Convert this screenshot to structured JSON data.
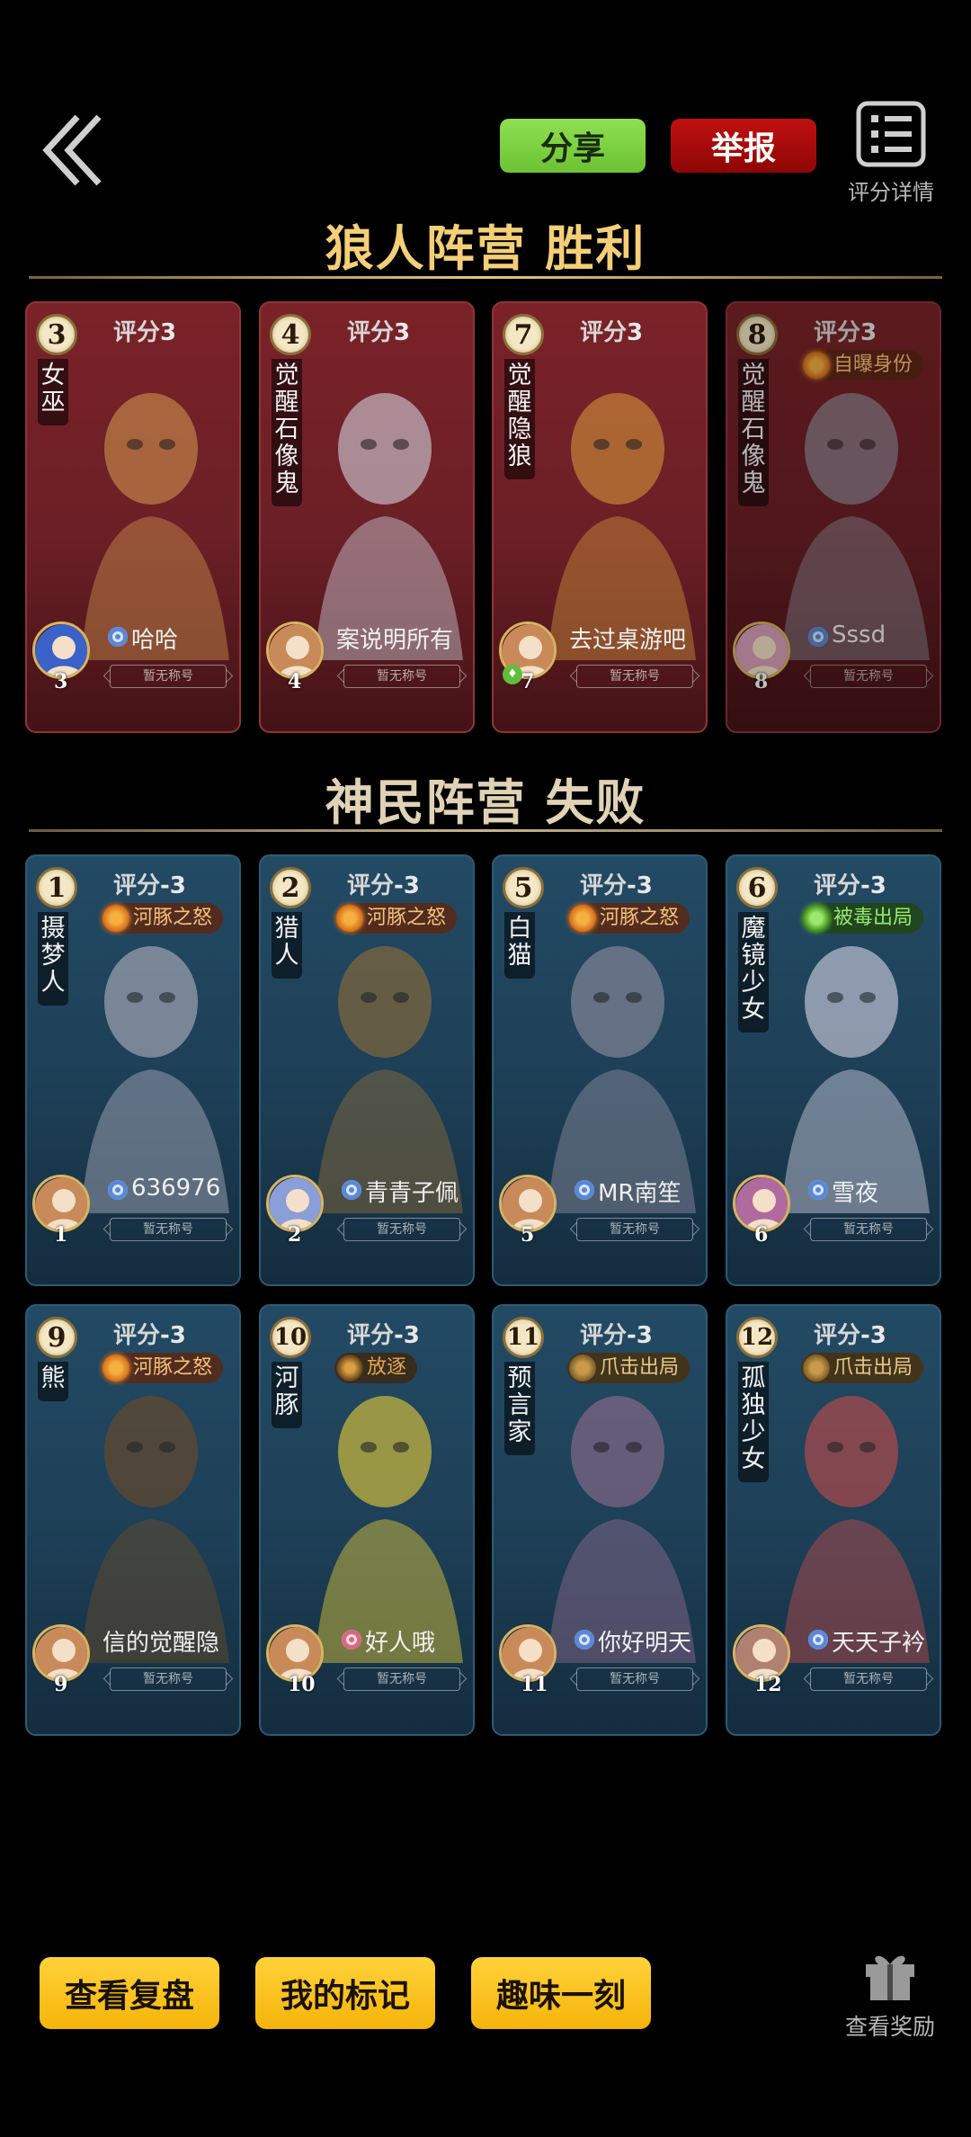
{
  "header": {
    "share_label": "分享",
    "report_label": "举报",
    "detail_label": "评分详情"
  },
  "sections": {
    "wolf_title": "狼人阵营  胜利",
    "villager_title": "神民阵营  失败"
  },
  "score_label": "评分",
  "no_nickname_label": "暂无称号",
  "players": {
    "wolf": [
      {
        "seat": "3",
        "score": "3",
        "role": "女巫",
        "nickname": "哈哈",
        "gender": "male",
        "badge": ""
      },
      {
        "seat": "4",
        "score": "3",
        "role": "觉醒石像鬼",
        "nickname": "案说明所有",
        "gender": "",
        "badge": ""
      },
      {
        "seat": "7",
        "score": "3",
        "role": "觉醒隐狼",
        "nickname": "去过桌游吧",
        "gender": "",
        "badge": ""
      },
      {
        "seat": "8",
        "score": "3",
        "role": "觉醒石像鬼",
        "nickname": "Sssd",
        "gender": "male",
        "badge": "自曝身份"
      }
    ],
    "villager": [
      {
        "seat": "1",
        "score": "-3",
        "role": "摄梦人",
        "nickname": "636976",
        "gender": "male",
        "badge": "河豚之怒"
      },
      {
        "seat": "2",
        "score": "-3",
        "role": "猎人",
        "nickname": "青青子佩",
        "gender": "male",
        "badge": "河豚之怒"
      },
      {
        "seat": "5",
        "score": "-3",
        "role": "白猫",
        "nickname": "MR南笙",
        "gender": "male",
        "badge": "河豚之怒"
      },
      {
        "seat": "6",
        "score": "-3",
        "role": "魔镜少女",
        "nickname": "雪夜",
        "gender": "male",
        "badge": "被毒出局"
      },
      {
        "seat": "9",
        "score": "-3",
        "role": "熊",
        "nickname": "信的觉醒隐",
        "gender": "",
        "badge": "河豚之怒"
      },
      {
        "seat": "10",
        "score": "-3",
        "role": "河豚",
        "nickname": "好人哦",
        "gender": "female",
        "badge": "放逐"
      },
      {
        "seat": "11",
        "score": "-3",
        "role": "预言家",
        "nickname": "你好明天",
        "gender": "male",
        "badge": "爪击出局"
      },
      {
        "seat": "12",
        "score": "-3",
        "role": "孤独少女",
        "nickname": "天天子衿",
        "gender": "male",
        "badge": "爪击出局"
      }
    ]
  },
  "bottom": {
    "replay_label": "查看复盘",
    "marks_label": "我的标记",
    "fun_label": "趣味一刻",
    "reward_label": "查看奖励"
  },
  "colors": {
    "wolf_card": "#6b1f26",
    "villager_card": "#1d3f56",
    "title_gold": "#f4cf77",
    "share_green": "#7fd044",
    "report_red": "#a80808",
    "bottom_yellow": "#fcc526"
  },
  "icons": {
    "back": "double-chevron-left-icon",
    "detail": "list-icon",
    "reward": "gift-icon"
  }
}
